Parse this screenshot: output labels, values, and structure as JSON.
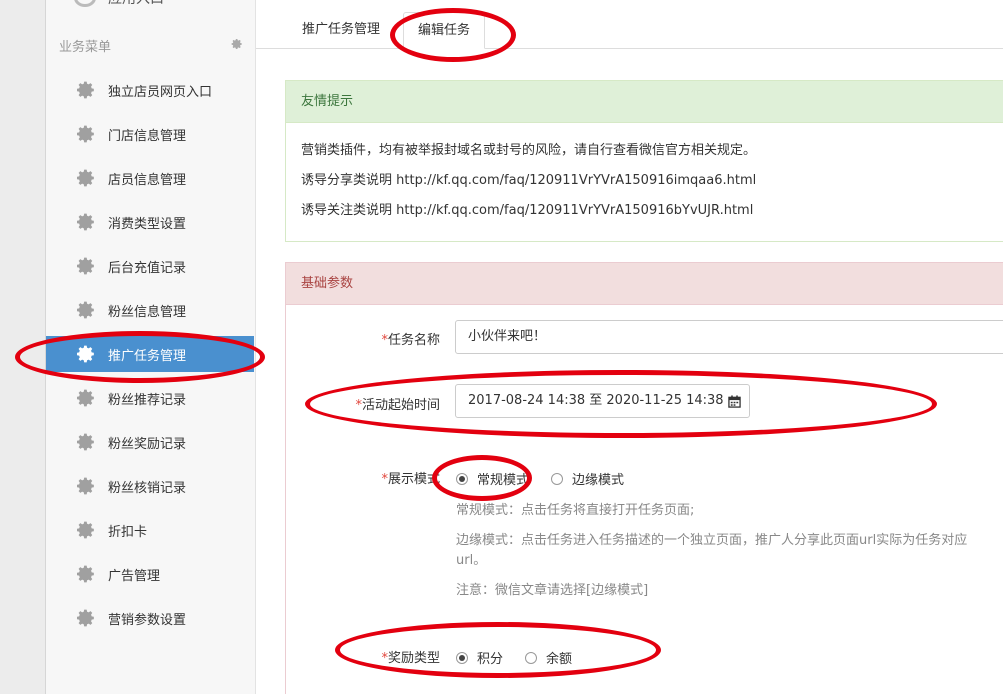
{
  "sidebar": {
    "top_item": "应用入口",
    "section_title": "业务菜单",
    "items": [
      {
        "label": "独立店员网页入口",
        "active": false
      },
      {
        "label": "门店信息管理",
        "active": false
      },
      {
        "label": "店员信息管理",
        "active": false
      },
      {
        "label": "消费类型设置",
        "active": false
      },
      {
        "label": "后台充值记录",
        "active": false
      },
      {
        "label": "粉丝信息管理",
        "active": false
      },
      {
        "label": "推广任务管理",
        "active": true
      },
      {
        "label": "粉丝推荐记录",
        "active": false
      },
      {
        "label": "粉丝奖励记录",
        "active": false
      },
      {
        "label": "粉丝核销记录",
        "active": false
      },
      {
        "label": "折扣卡",
        "active": false
      },
      {
        "label": "广告管理",
        "active": false
      },
      {
        "label": "营销参数设置",
        "active": false
      }
    ]
  },
  "tabs": [
    {
      "label": "推广任务管理"
    },
    {
      "label": "编辑任务",
      "active": true
    }
  ],
  "info_panel": {
    "title": "友情提示",
    "lines": [
      "营销类插件，均有被举报封域名或封号的风险，请自行查看微信官方相关规定。",
      "诱导分享类说明 http://kf.qq.com/faq/120911VrYVrA150916imqaa6.html",
      "诱导关注类说明 http://kf.qq.com/faq/120911VrYVrA150916bYvUJR.html"
    ]
  },
  "basic_panel": {
    "title": "基础参数",
    "required_mark": "*",
    "task_name_label": "任务名称",
    "task_name_value": "小伙伴来吧！",
    "time_label": "活动起始时间",
    "time_value": "2017-08-24 14:38 至 2020-11-25 14:38",
    "display_label": "展示模式",
    "display_options": [
      {
        "label": "常规模式",
        "checked": true
      },
      {
        "label": "边缘模式",
        "checked": false
      }
    ],
    "help_regular": "常规模式：点击任务将直接打开任务页面;",
    "help_edge_1": "边缘模式：点击任务进入任务描述的一个独立页面，推广人分享此页面url实际为任务对应",
    "help_edge_2": "url。",
    "help_note": "注意：微信文章请选择[边缘模式]",
    "reward_label": "奖励类型",
    "reward_options": [
      {
        "label": "积分",
        "checked": true
      },
      {
        "label": "余额",
        "checked": false
      }
    ]
  },
  "colors": {
    "active_menu": "#4a90cf",
    "info_header_bg": "#dff0d8",
    "basic_header_bg": "#f2dede",
    "annotation": "#e3000f"
  }
}
